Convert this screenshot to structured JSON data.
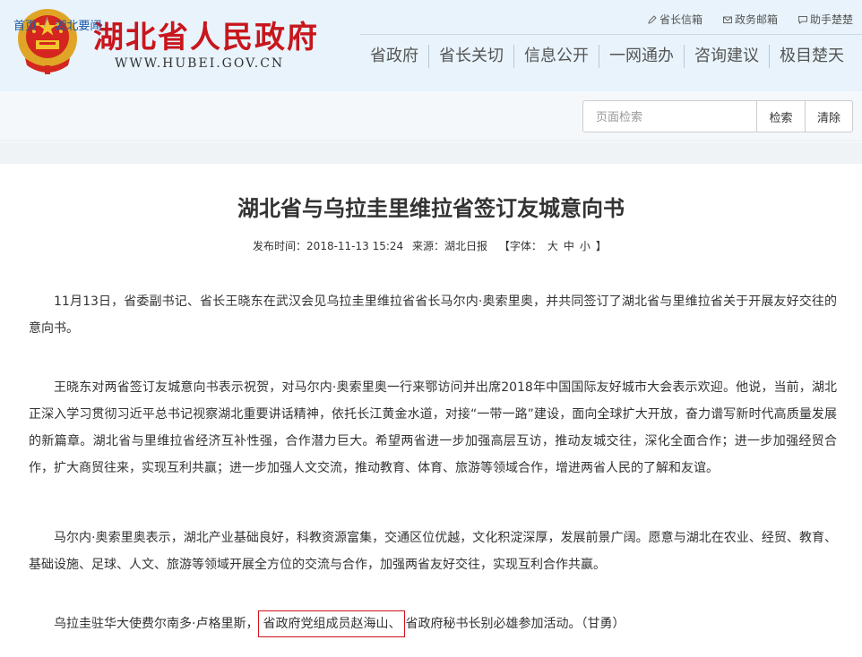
{
  "header": {
    "site_title": "湖北省人民政府",
    "site_url": "WWW.HUBEI.GOV.CN",
    "quick_links": [
      "省长信箱",
      "政务邮箱",
      "助手楚楚"
    ],
    "nav": [
      "省政府",
      "省长关切",
      "信息公开",
      "一网通办",
      "咨询建议",
      "极目楚天"
    ]
  },
  "breadcrumb": {
    "home": "首页",
    "separator": "/",
    "current": "湖北要闻"
  },
  "search": {
    "placeholder": "页面检索",
    "search_label": "检索",
    "clear_label": "清除"
  },
  "article": {
    "title": "湖北省与乌拉圭里维拉省签订友城意向书",
    "publish_time": "发布时间：2018-11-13 15:24",
    "source": "来源：湖北日报",
    "font_label_open": "【字体：",
    "font_sizes": [
      "大",
      "中",
      "小"
    ],
    "font_label_close": "】",
    "paragraphs": [
      "11月13日，省委副书记、省长王晓东在武汉会见乌拉圭里维拉省省长马尔内·奥索里奥，并共同签订了湖北省与里维拉省关于开展友好交往的意向书。",
      "王晓东对两省签订友城意向书表示祝贺，对马尔内·奥索里奥一行来鄂访问并出席2018年中国国际友好城市大会表示欢迎。他说，当前，湖北正深入学习贯彻习近平总书记视察湖北重要讲话精神，依托长江黄金水道，对接“一带一路”建设，面向全球扩大开放，奋力谱写新时代高质量发展的新篇章。湖北省与里维拉省经济互补性强，合作潜力巨大。希望两省进一步加强高层互访，推动友城交往，深化全面合作；进一步加强经贸合作，扩大商贸往来，实现互利共赢；进一步加强人文交流，推动教育、体育、旅游等领域合作，增进两省人民的了解和友谊。",
      "马尔内·奥索里奥表示，湖北产业基础良好，科教资源富集，交通区位优越，文化积淀深厚，发展前景广阔。愿意与湖北在农业、经贸、教育、基础设施、足球、人文、旅游等领域开展全方位的交流与合作，加强两省友好交往，实现互利合作共赢。"
    ],
    "last_paragraph": {
      "before": "乌拉圭驻华大使费尔南多·卢格里斯，",
      "highlighted": "省政府党组成员赵海山、",
      "after": "省政府秘书长别必雄参加活动。（甘勇）"
    }
  },
  "colors": {
    "brand_red": "#c8161d",
    "header_bg": "#e8f3fb",
    "link_blue": "#1a5aa8",
    "highlight_border": "#d0121b"
  }
}
